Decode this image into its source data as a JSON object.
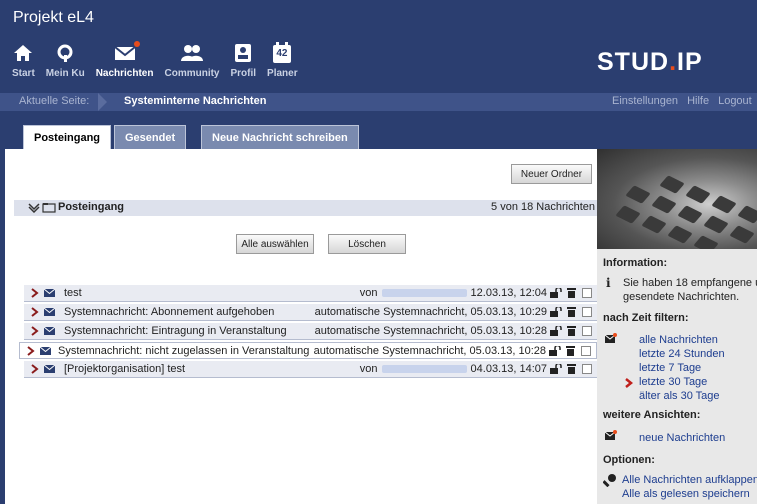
{
  "app": {
    "title": "Projekt eL4",
    "logo_a": "STUD",
    "logo_dot": ".",
    "logo_b": "IP"
  },
  "nav": [
    {
      "label": "Start",
      "icon": "home-icon"
    },
    {
      "label": "Mein Ku",
      "icon": "courses-icon"
    },
    {
      "label": "Nachrichten",
      "icon": "envelope-icon",
      "active": true
    },
    {
      "label": "Community",
      "icon": "community-icon"
    },
    {
      "label": "Profil",
      "icon": "profile-icon"
    },
    {
      "label": "Planer",
      "icon": "calendar-icon",
      "badge": "42"
    }
  ],
  "breadcrumb": {
    "label": "Aktuelle Seite:",
    "page": "Systeminterne Nachrichten",
    "links": [
      "Einstellungen",
      "Hilfe",
      "Logout"
    ]
  },
  "tabs": [
    "Posteingang",
    "Gesendet",
    "Neue Nachricht schreiben"
  ],
  "toolbar": {
    "new_folder": "Neuer Ordner",
    "select_all": "Alle auswählen",
    "delete": "Löschen"
  },
  "folder": {
    "title": "Posteingang",
    "count": "5 von 18 Nachrichten"
  },
  "messages": [
    {
      "subject": "test",
      "from_prefix": "von",
      "date": "12.03.13, 12:04"
    },
    {
      "subject": "Systemnachricht: Abonnement aufgehoben",
      "from_prefix": "automatische Systemnachricht,",
      "date": "05.03.13, 10:29"
    },
    {
      "subject": "Systemnachricht: Eintragung in Veranstaltung",
      "from_prefix": "automatische Systemnachricht,",
      "date": "05.03.13, 10:28"
    },
    {
      "subject": "Systemnachricht: nicht zugelassen in Veranstaltung",
      "from_prefix": "automatische Systemnachricht,",
      "date": "05.03.13, 10:28"
    },
    {
      "subject": "[Projektorganisation] test",
      "from_prefix": "von",
      "date": "04.03.13, 14:07"
    }
  ],
  "sidebar": {
    "info_title": "Information:",
    "info_text": [
      "Sie haben 18 empfangene u",
      "gesendete Nachrichten."
    ],
    "time_title": "nach Zeit filtern:",
    "time_filters": [
      "alle Nachrichten",
      "letzte 24 Stunden",
      "letzte 7 Tage",
      "letzte 30 Tage",
      "älter als 30 Tage"
    ],
    "views_title": "weitere Ansichten:",
    "views": [
      "neue Nachrichten"
    ],
    "options_title": "Optionen:",
    "options": [
      "Alle Nachrichten aufklappen",
      "Alle als gelesen speichern"
    ]
  },
  "colors": {
    "header": "#2b3e70",
    "crumb": "#3f5389",
    "accent": "#e84d1c",
    "row": "#e9ebf2",
    "link": "#1d3d8f"
  }
}
